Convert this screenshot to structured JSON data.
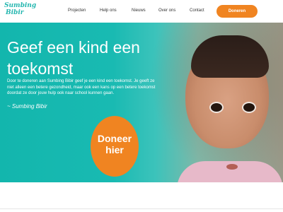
{
  "header": {
    "logo_line1": "Sumbing",
    "logo_line2": "Bibir",
    "nav": [
      "Projecten",
      "Help ons",
      "Nieuws",
      "Over ons",
      "Contact"
    ],
    "donate_label": "Doneren"
  },
  "hero": {
    "title_line1": "Geef een kind een",
    "title_line2": "toekomst",
    "text": "Door te doneren aan Sumbing Bibir geef je een kind een toekomst. Je geeft ze niet alleen een betere gezondheid, maar ook een kans op een betere toekomst doordat ze door jouw hulp ook naar school kunnen gaan.",
    "signature": "~ Sumbing Bibir",
    "cta_line1": "Doneer",
    "cta_line2": "hier"
  },
  "colors": {
    "accent": "#f08421",
    "brand": "#26b7b0"
  }
}
